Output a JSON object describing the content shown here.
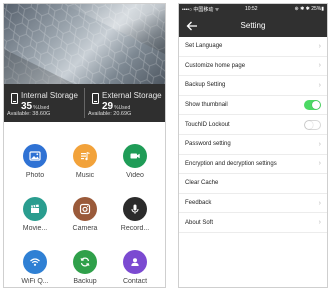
{
  "left_screen": {
    "storage": {
      "internal": {
        "label": "Internal Storage",
        "value": "35",
        "unit": "%Used",
        "available": "Available: 38.60G"
      },
      "external": {
        "label": "External Storage",
        "value": "29",
        "unit": "%Used",
        "available": "Available: 20.69G"
      }
    },
    "apps": [
      {
        "label": "Photo",
        "icon": "photo-icon",
        "color": "#2f72d4"
      },
      {
        "label": "Music",
        "icon": "music-icon",
        "color": "#f2a23a"
      },
      {
        "label": "Video",
        "icon": "video-icon",
        "color": "#1f9c57"
      },
      {
        "label": "Movie...",
        "icon": "clapperboard-icon",
        "color": "#2a9d8f"
      },
      {
        "label": "Camera",
        "icon": "camera-icon",
        "color": "#9a5a3a"
      },
      {
        "label": "Record...",
        "icon": "microphone-icon",
        "color": "#2b2b2b"
      },
      {
        "label": "WiFi Q...",
        "icon": "wifi-icon",
        "color": "#2f80d4"
      },
      {
        "label": "Backup",
        "icon": "sync-icon",
        "color": "#2fa04a"
      },
      {
        "label": "Contact",
        "icon": "contact-icon",
        "color": "#7b4ad1"
      }
    ]
  },
  "right_screen": {
    "status_bar": {
      "carrier": "••••○ 中国移动 ᯤ",
      "time": "10:52",
      "indicators": "⊕ ✱ ✱ 25%▮"
    },
    "header": {
      "title": "Setting"
    },
    "settings": [
      {
        "label": "Set Language",
        "control": "chevron"
      },
      {
        "label": "Customize home page",
        "control": "chevron"
      },
      {
        "label": "Backup Setting",
        "control": "chevron"
      },
      {
        "label": "Show thumbnail",
        "control": "toggle",
        "state": "on"
      },
      {
        "label": "TouchID Lockout",
        "control": "toggle",
        "state": "off"
      },
      {
        "label": "Password setting",
        "control": "chevron"
      },
      {
        "label": "Encryption and decryption settings",
        "control": "chevron"
      },
      {
        "label": "Clear Cache",
        "control": "none"
      },
      {
        "label": "Feedback",
        "control": "chevron"
      },
      {
        "label": "About Soft",
        "control": "chevron"
      }
    ],
    "colors": {
      "toggle_on": "#4cd964",
      "header_bg": "#303030"
    }
  }
}
